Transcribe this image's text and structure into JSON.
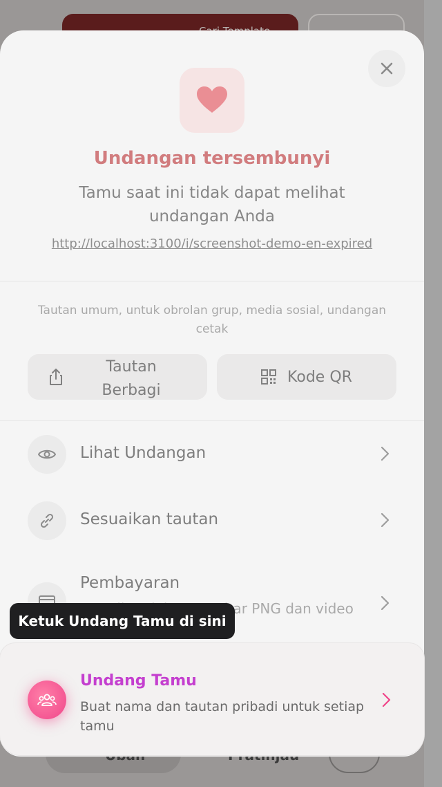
{
  "background": {
    "banner_label": "Cari Template",
    "bottom_button_1": "Ubah",
    "bottom_button_2": "Pratinjau"
  },
  "sheet": {
    "title": "Undangan tersembunyi",
    "subtitle": "Tamu saat ini tidak dapat melihat undangan Anda",
    "link": "http://localhost:3100/i/screenshot-demo-en-expired",
    "hint": "Tautan umum, untuk obrolan grup, media sosial, undangan cetak",
    "share_button": "Tautan Berbagi",
    "qr_button": "Kode QR",
    "menu": [
      {
        "label": "Lihat Undangan",
        "icon": "eye-icon"
      },
      {
        "label": "Sesuaikan tautan",
        "icon": "link-icon"
      },
      {
        "label": "Pembayaran",
        "sub": "Tampilan dalam gambar PNG dan video",
        "icon": "card-icon"
      }
    ]
  },
  "highlight": {
    "title": "Undang Tamu",
    "subtitle": "Buat nama dan tautan pribadi untuk setiap tamu"
  },
  "tooltip": {
    "text": "Ketuk Undang Tamu di sini"
  },
  "colors": {
    "title_red": "#b2191d",
    "accent_pink": "#f0468a",
    "accent_purple": "#c43fcf",
    "tooltip_bg": "#1f1f21"
  }
}
